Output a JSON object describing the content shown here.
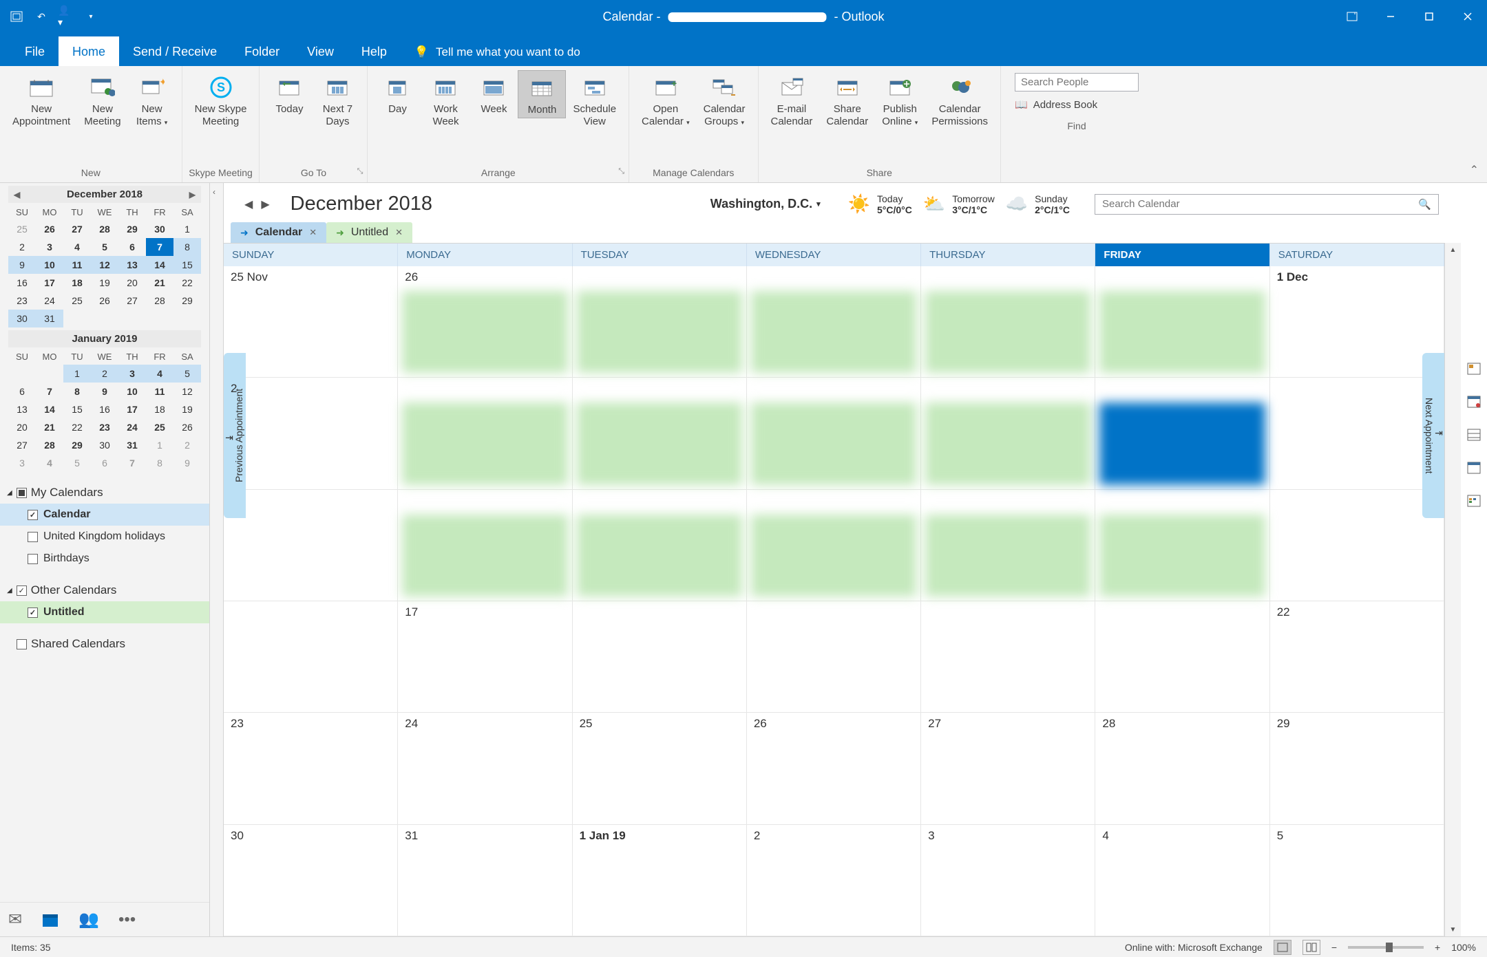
{
  "titlebar": {
    "prefix": "Calendar - ",
    "suffix": " - Outlook"
  },
  "tabs": {
    "file": "File",
    "home": "Home",
    "send_receive": "Send / Receive",
    "folder": "Folder",
    "view": "View",
    "help": "Help",
    "tellme": "Tell me what you want to do"
  },
  "ribbon": {
    "groups": {
      "new": "New",
      "skype": "Skype Meeting",
      "goto": "Go To",
      "arrange": "Arrange",
      "manage": "Manage Calendars",
      "share": "Share",
      "find": "Find"
    },
    "btns": {
      "new_appointment": "New\nAppointment",
      "new_meeting": "New\nMeeting",
      "new_items": "New\nItems",
      "new_skype": "New Skype\nMeeting",
      "today": "Today",
      "next7": "Next 7\nDays",
      "day": "Day",
      "work_week": "Work\nWeek",
      "week": "Week",
      "month": "Month",
      "schedule_view": "Schedule\nView",
      "open_calendar": "Open\nCalendar",
      "calendar_groups": "Calendar\nGroups",
      "email_calendar": "E-mail\nCalendar",
      "share_calendar": "Share\nCalendar",
      "publish_online": "Publish\nOnline",
      "calendar_permissions": "Calendar\nPermissions"
    },
    "search_people_placeholder": "Search People",
    "address_book": "Address Book"
  },
  "minical1": {
    "title": "December 2018",
    "dayheaders": [
      "SU",
      "MO",
      "TU",
      "WE",
      "TH",
      "FR",
      "SA"
    ],
    "rows": [
      [
        {
          "n": "25",
          "dim": true
        },
        {
          "n": "26",
          "bold": true
        },
        {
          "n": "27",
          "bold": true
        },
        {
          "n": "28",
          "bold": true
        },
        {
          "n": "29",
          "bold": true
        },
        {
          "n": "30",
          "bold": true
        },
        {
          "n": "1"
        }
      ],
      [
        {
          "n": "2"
        },
        {
          "n": "3",
          "bold": true
        },
        {
          "n": "4",
          "bold": true
        },
        {
          "n": "5",
          "bold": true
        },
        {
          "n": "6",
          "bold": true
        },
        {
          "n": "7",
          "today": true
        },
        {
          "n": "8",
          "hl": true
        }
      ],
      [
        {
          "n": "9",
          "hl": true
        },
        {
          "n": "10",
          "bold": true,
          "hl": true
        },
        {
          "n": "11",
          "bold": true,
          "hl": true
        },
        {
          "n": "12",
          "bold": true,
          "hl": true
        },
        {
          "n": "13",
          "bold": true,
          "hl": true
        },
        {
          "n": "14",
          "bold": true,
          "hl": true
        },
        {
          "n": "15",
          "hl": true
        }
      ],
      [
        {
          "n": "16"
        },
        {
          "n": "17",
          "bold": true
        },
        {
          "n": "18",
          "bold": true
        },
        {
          "n": "19"
        },
        {
          "n": "20"
        },
        {
          "n": "21",
          "bold": true
        },
        {
          "n": "22"
        }
      ],
      [
        {
          "n": "23"
        },
        {
          "n": "24"
        },
        {
          "n": "25"
        },
        {
          "n": "26"
        },
        {
          "n": "27"
        },
        {
          "n": "28"
        },
        {
          "n": "29"
        }
      ],
      [
        {
          "n": "30",
          "hl": true
        },
        {
          "n": "31",
          "hl": true
        },
        {
          "n": "",
          "dim": true
        },
        {
          "n": "",
          "dim": true
        },
        {
          "n": "",
          "dim": true
        },
        {
          "n": "",
          "dim": true
        },
        {
          "n": "",
          "dim": true
        }
      ]
    ]
  },
  "minical2": {
    "title": "January 2019",
    "dayheaders": [
      "SU",
      "MO",
      "TU",
      "WE",
      "TH",
      "FR",
      "SA"
    ],
    "rows": [
      [
        {
          "n": ""
        },
        {
          "n": ""
        },
        {
          "n": "1",
          "hl": true
        },
        {
          "n": "2",
          "hl": true
        },
        {
          "n": "3",
          "bold": true,
          "hl": true
        },
        {
          "n": "4",
          "bold": true,
          "hl": true
        },
        {
          "n": "5",
          "hl": true
        }
      ],
      [
        {
          "n": "6"
        },
        {
          "n": "7",
          "bold": true
        },
        {
          "n": "8",
          "bold": true
        },
        {
          "n": "9",
          "bold": true
        },
        {
          "n": "10",
          "bold": true
        },
        {
          "n": "11",
          "bold": true
        },
        {
          "n": "12"
        }
      ],
      [
        {
          "n": "13"
        },
        {
          "n": "14",
          "bold": true
        },
        {
          "n": "15"
        },
        {
          "n": "16"
        },
        {
          "n": "17",
          "bold": true
        },
        {
          "n": "18"
        },
        {
          "n": "19"
        }
      ],
      [
        {
          "n": "20"
        },
        {
          "n": "21",
          "bold": true
        },
        {
          "n": "22"
        },
        {
          "n": "23",
          "bold": true
        },
        {
          "n": "24",
          "bold": true
        },
        {
          "n": "25",
          "bold": true
        },
        {
          "n": "26"
        }
      ],
      [
        {
          "n": "27"
        },
        {
          "n": "28",
          "bold": true
        },
        {
          "n": "29",
          "bold": true
        },
        {
          "n": "30"
        },
        {
          "n": "31",
          "bold": true
        },
        {
          "n": "1",
          "dim": true
        },
        {
          "n": "2",
          "dim": true
        }
      ],
      [
        {
          "n": "3",
          "dim": true
        },
        {
          "n": "4",
          "bold": true,
          "dim": true
        },
        {
          "n": "5",
          "dim": true
        },
        {
          "n": "6",
          "dim": true
        },
        {
          "n": "7",
          "bold": true,
          "dim": true
        },
        {
          "n": "8",
          "dim": true
        },
        {
          "n": "9",
          "dim": true
        }
      ]
    ]
  },
  "calsections": {
    "my_calendars": "My Calendars",
    "other_calendars": "Other Calendars",
    "shared_calendars": "Shared Calendars",
    "calendar": "Calendar",
    "uk_holidays": "United Kingdom holidays",
    "birthdays": "Birthdays",
    "untitled": "Untitled"
  },
  "content": {
    "month_title": "December 2018",
    "location": "Washington,  D.C.",
    "weather": {
      "today_label": "Today",
      "today_temp": "5°C/0°C",
      "tomorrow_label": "Tomorrow",
      "tomorrow_temp": "3°C/1°C",
      "sunday_label": "Sunday",
      "sunday_temp": "2°C/1°C"
    },
    "search_placeholder": "Search Calendar",
    "tab_calendar": "Calendar",
    "tab_untitled": "Untitled",
    "columns": [
      "SUNDAY",
      "MONDAY",
      "TUESDAY",
      "WEDNESDAY",
      "THURSDAY",
      "FRIDAY",
      "SATURDAY"
    ],
    "prev_appt": "Previous Appointment",
    "next_appt": "Next Appointment",
    "cells": [
      [
        "25 Nov",
        "26",
        "",
        "",
        "",
        "",
        "1 Dec"
      ],
      [
        "2",
        "",
        "",
        "",
        "",
        "",
        ""
      ],
      [
        "",
        "",
        "",
        "",
        "",
        "",
        ""
      ],
      [
        "",
        "17",
        "",
        "",
        "",
        "",
        "22"
      ],
      [
        "23",
        "24",
        "25",
        "26",
        "27",
        "28",
        "29"
      ],
      [
        "30",
        "31",
        "1 Jan 19",
        "2",
        "3",
        "4",
        "5"
      ]
    ],
    "bold_dates": {
      "0-6": true,
      "5-2": true
    },
    "events": [
      {
        "row": 0,
        "colStart": 1,
        "colEnd": 5,
        "cls": "ev-green"
      },
      {
        "row": 1,
        "colStart": 1,
        "colEnd": 4,
        "cls": "ev-green"
      },
      {
        "row": 1,
        "colStart": 5,
        "colEnd": 5,
        "cls": "ev-blue"
      },
      {
        "row": 2,
        "colStart": 1,
        "colEnd": 5,
        "cls": "ev-green"
      }
    ]
  },
  "statusbar": {
    "items": "Items: 35",
    "online": "Online with: Microsoft Exchange",
    "zoom": "100%"
  }
}
